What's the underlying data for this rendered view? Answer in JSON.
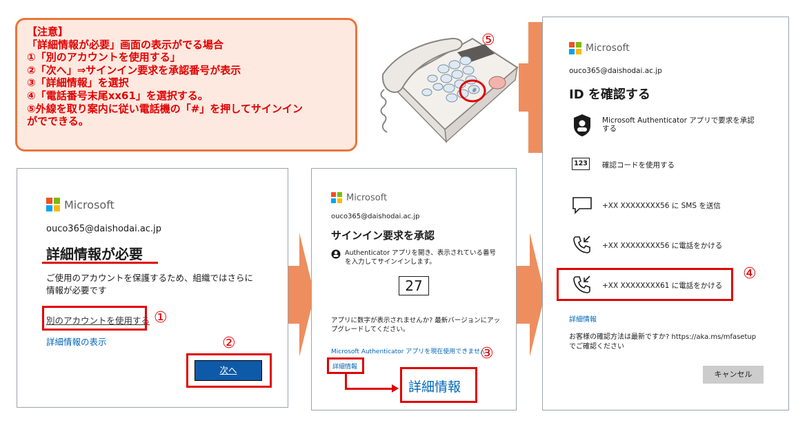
{
  "note": {
    "lines": [
      "【注意】",
      "「詳細情報が必要」画面の表示がでる場合",
      "①「別のアカウントを使用する」",
      "②「次へ」⇒サインイン要求を承認番号が表示",
      "③「詳細情報」を選択",
      "④「電話番号末尾xx61」を選択する。",
      "⑤外線を取り案内に従い電話機の「#」を押してサインイン",
      "がでできる。"
    ]
  },
  "markers": {
    "m1": "①",
    "m2": "②",
    "m3": "③",
    "m4": "④",
    "m5": "⑤"
  },
  "panel1": {
    "brand": "Microsoft",
    "email": "ouco365@daishodai.ac.jp",
    "title": "詳細情報が必要",
    "desc": "ご使用のアカウントを保護するため、組織ではさらに情報が必要です",
    "other_account_link": "別のアカウントを使用する",
    "more_info_link": "詳細情報の表示",
    "next_button": "次へ"
  },
  "panel2": {
    "brand": "Microsoft",
    "email": "ouco365@daishodai.ac.jp",
    "title": "サインイン要求を承認",
    "instruction": "Authenticator アプリを開き、表示されている番号を入力してサインインします。",
    "number": "27",
    "no_number_text": "アプリに数字が表示されませんか? 最新バージョンにアップグレードしてください。",
    "cant_use_link": "Microsoft Authenticator アプリを現在使用できません",
    "details_link": "詳細情報",
    "details_zoom": "詳細情報"
  },
  "panel3": {
    "brand": "Microsoft",
    "email": "ouco365@daishodai.ac.jp",
    "title": "ID を確認する",
    "options": [
      {
        "icon": "authenticator-lock-icon",
        "label": "Microsoft Authenticator アプリで要求を承認する"
      },
      {
        "icon": "code-123-icon",
        "icon_text": "123",
        "label": "確認コードを使用する"
      },
      {
        "icon": "sms-chat-icon",
        "label": "+XX XXXXXXXX56 に SMS を送信"
      },
      {
        "icon": "phone-call-icon",
        "label": "+XX XXXXXXXX56 に電話をかける"
      },
      {
        "icon": "phone-call-icon",
        "label": "+XX XXXXXXXX61 に電話をかける"
      }
    ],
    "details_link": "詳細情報",
    "footer_text": "お客様の確認方法は最新ですか? https://aka.ms/mfasetup でご確認ください",
    "cancel_button": "キャンセル"
  },
  "colors": {
    "accent_red": "#e00000",
    "arrow_orange": "#ee8e5e",
    "ms_blue": "#0067b8",
    "next_btn": "#0f5aa8"
  }
}
